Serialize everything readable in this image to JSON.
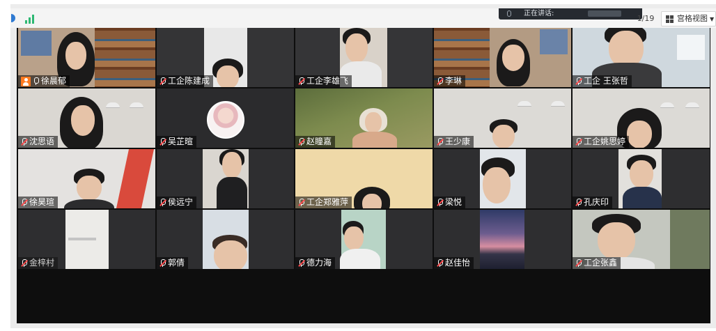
{
  "toolbar": {
    "speaking_label": "正在讲话:",
    "page_indicator": "1/19",
    "view_label": "宫格视图",
    "colors": {
      "signal": "#2eb872",
      "host_badge": "#ff7a1f"
    }
  },
  "participants": [
    {
      "name": "徐晨郁",
      "host": true,
      "mic": "active"
    },
    {
      "name": "工企陈建成",
      "host": false,
      "mic": "muted"
    },
    {
      "name": "工企李雄飞",
      "host": false,
      "mic": "muted"
    },
    {
      "name": "李琳",
      "host": false,
      "mic": "muted"
    },
    {
      "name": "工企 王张哲",
      "host": false,
      "mic": "muted"
    },
    {
      "name": "沈思语",
      "host": false,
      "mic": "muted"
    },
    {
      "name": "吴芷暄",
      "host": false,
      "mic": "muted"
    },
    {
      "name": "赵瞳嘉",
      "host": false,
      "mic": "muted"
    },
    {
      "name": "王少康",
      "host": false,
      "mic": "muted"
    },
    {
      "name": "工企姚思婷",
      "host": false,
      "mic": "muted"
    },
    {
      "name": "徐昊瑄",
      "host": false,
      "mic": "muted"
    },
    {
      "name": "侯远宁",
      "host": false,
      "mic": "muted"
    },
    {
      "name": "工企郑雅萍",
      "host": false,
      "mic": "muted"
    },
    {
      "name": "梁悦",
      "host": false,
      "mic": "muted"
    },
    {
      "name": "孔庆印",
      "host": false,
      "mic": "muted"
    },
    {
      "name": "金梓村",
      "host": false,
      "mic": "muted"
    },
    {
      "name": "郭倩",
      "host": false,
      "mic": "muted"
    },
    {
      "name": "德力海",
      "host": false,
      "mic": "muted"
    },
    {
      "name": "赵佳怡",
      "host": false,
      "mic": "muted"
    },
    {
      "name": "工企张鑫",
      "host": false,
      "mic": "muted"
    }
  ]
}
